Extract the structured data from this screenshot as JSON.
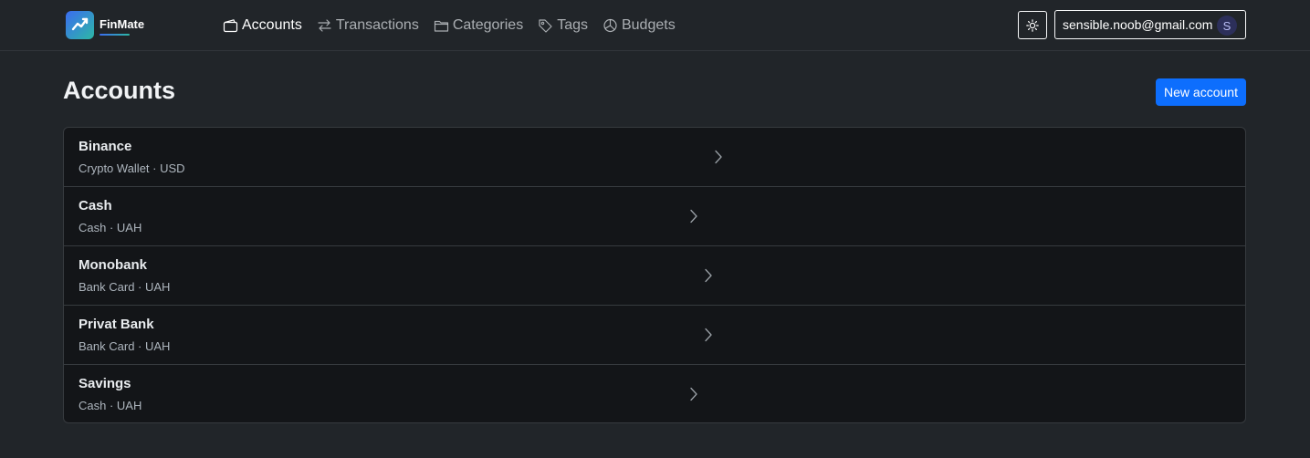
{
  "app": {
    "brand_name": "FinMate"
  },
  "nav": {
    "items": [
      {
        "label": "Accounts",
        "icon": "wallet-icon",
        "active": true
      },
      {
        "label": "Transactions",
        "icon": "arrows-exchange-icon",
        "active": false
      },
      {
        "label": "Categories",
        "icon": "folder-icon",
        "active": false
      },
      {
        "label": "Tags",
        "icon": "tag-icon",
        "active": false
      },
      {
        "label": "Budgets",
        "icon": "pie-chart-icon",
        "active": false
      }
    ],
    "theme_toggle_icon": "sun-icon",
    "user": {
      "email": "sensible.noob@gmail.com",
      "avatar_initial": "S"
    }
  },
  "page": {
    "title": "Accounts",
    "new_button_label": "New account"
  },
  "accounts": [
    {
      "name": "Binance",
      "subtitle": "Crypto Wallet · USD"
    },
    {
      "name": "Cash",
      "subtitle": "Cash · UAH"
    },
    {
      "name": "Monobank",
      "subtitle": "Bank Card · UAH"
    },
    {
      "name": "Privat Bank",
      "subtitle": "Bank Card · UAH"
    },
    {
      "name": "Savings",
      "subtitle": "Cash · UAH"
    }
  ],
  "colors": {
    "background": "#212529",
    "list_background": "#131518",
    "primary": "#0d6efd",
    "brand_gradient_start": "#3b6cf0",
    "brand_gradient_end": "#2db8a5"
  }
}
